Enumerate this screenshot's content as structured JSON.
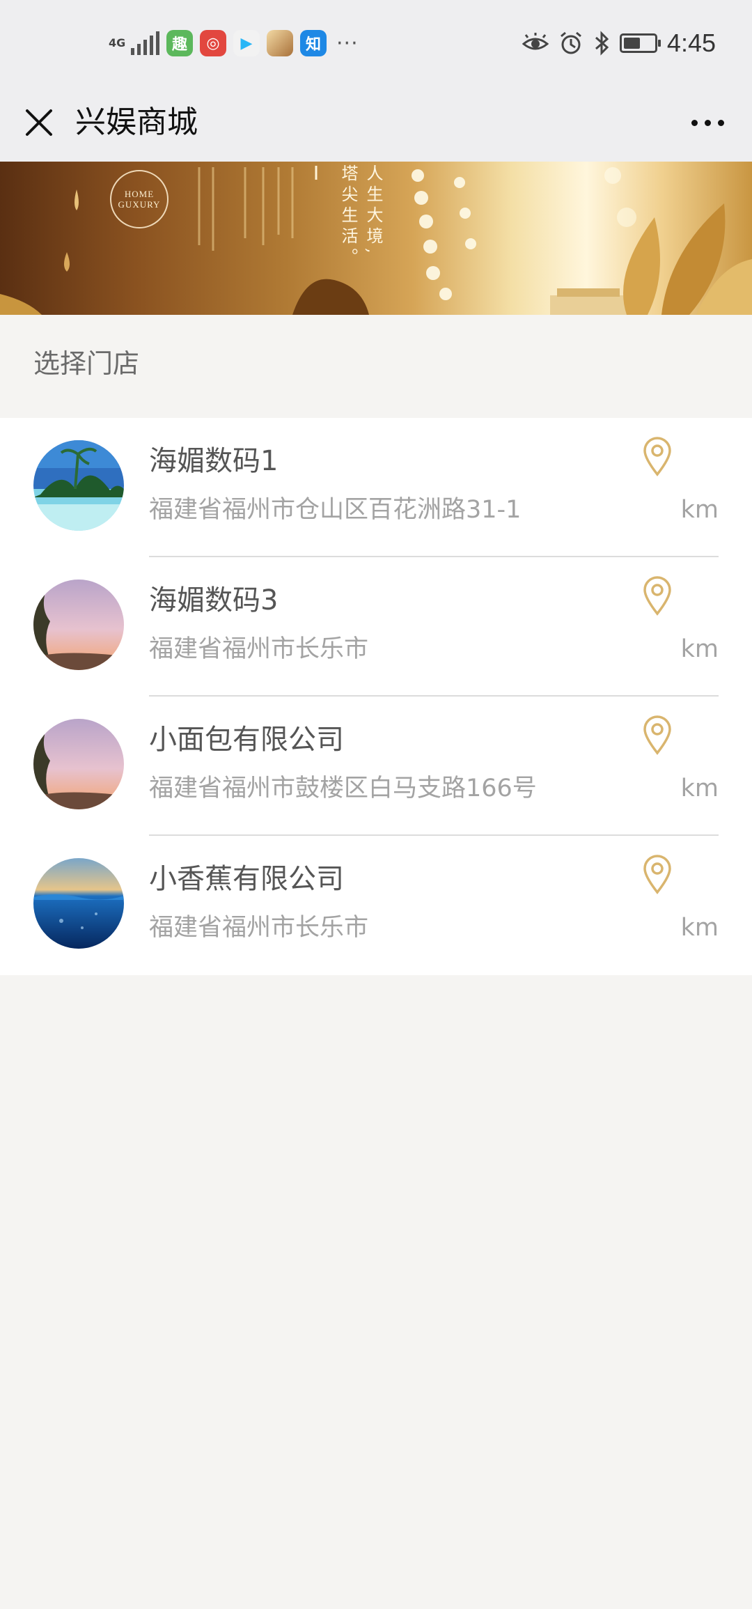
{
  "status_bar": {
    "network": "4G",
    "apps": [
      {
        "name": "qutoutiao-app-icon",
        "glyph": "趣",
        "color": "#5cb85c"
      },
      {
        "name": "netease-music-app-icon",
        "glyph": "◎",
        "color": "#e2473f"
      },
      {
        "name": "video-play-app-icon",
        "glyph": "▶",
        "color": "#f2f2f2"
      },
      {
        "name": "game-app-icon",
        "glyph": "",
        "color": "#c9a36b"
      },
      {
        "name": "zhihu-app-icon",
        "glyph": "知",
        "color": "#1e88e5"
      }
    ],
    "more": "···",
    "battery_level": 0.55,
    "time": "4:45"
  },
  "header": {
    "title": "兴娱商城"
  },
  "banner": {
    "logo_line1": "HOME",
    "logo_line2": "GUXURY",
    "slogan": "人生大境,塔尖生活。"
  },
  "section": {
    "title": "选择门店"
  },
  "stores": [
    {
      "name": "海媚数码1",
      "address": "福建省福州市仓山区百花洲路31-1",
      "distance": "",
      "unit": "km",
      "thumb": "beach"
    },
    {
      "name": "海媚数码3",
      "address": "福建省福州市长乐市",
      "distance": "",
      "unit": "km",
      "thumb": "sunset"
    },
    {
      "name": "小面包有限公司",
      "address": "福建省福州市鼓楼区白马支路166号",
      "distance": "",
      "unit": "km",
      "thumb": "sunset"
    },
    {
      "name": "小香蕉有限公司",
      "address": "福建省福州市长乐市",
      "distance": "",
      "unit": "km",
      "thumb": "ocean"
    }
  ],
  "colors": {
    "accent_gold": "#d9b56e",
    "text_primary": "#555555",
    "text_secondary": "#a3a3a3"
  }
}
